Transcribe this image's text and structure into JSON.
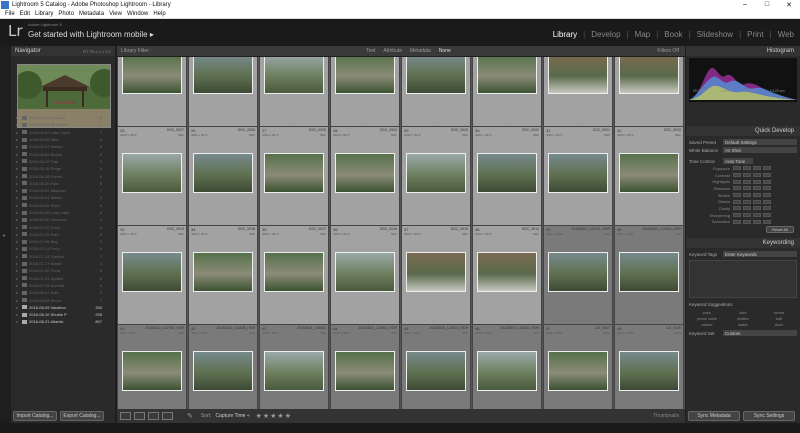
{
  "window": {
    "title": "Lightroom 5 Catalog - Adobe Photoshop Lightroom - Library",
    "controls": [
      "–",
      "□",
      "✕"
    ]
  },
  "menu": [
    "File",
    "Edit",
    "Library",
    "Photo",
    "Metadata",
    "View",
    "Window",
    "Help"
  ],
  "identity": {
    "logo": "Lr",
    "sub": "Adobe Lightroom 5",
    "main": "Get started with Lightroom mobile ▸"
  },
  "modules": [
    "Library",
    "Develop",
    "Map",
    "Book",
    "Slideshow",
    "Print",
    "Web"
  ],
  "active_module": "Library",
  "navigator": {
    "title": "Navigator",
    "options": "FIT  FILL  1:1  3:1"
  },
  "folders": [
    {
      "name": "2018-06-01 Lookout",
      "count": "6"
    },
    {
      "name": "2018-06-02 Mt Rainier",
      "count": "4"
    },
    {
      "name": "2018-06-03 Lake Clark",
      "count": "7"
    },
    {
      "name": "2018-06-05 Hike",
      "count": "8"
    },
    {
      "name": "2018-06-07 Harbor",
      "count": "5"
    },
    {
      "name": "2018-06-09 Beach",
      "count": "3"
    },
    {
      "name": "2018-06-12 Trail",
      "count": "9"
    },
    {
      "name": "2018-06-15 Ridge",
      "count": "4"
    },
    {
      "name": "2018-06-18 Forest",
      "count": "6"
    },
    {
      "name": "2018-06-20 Falls",
      "count": "5"
    },
    {
      "name": "2018-06-22 Meadow",
      "count": "7"
    },
    {
      "name": "2018-06-24 Marsh",
      "count": "3"
    },
    {
      "name": "2018-06-26 River",
      "count": "8"
    },
    {
      "name": "2018-06-28 Long Lake",
      "count": "6"
    },
    {
      "name": "2018-06-30 Overlook",
      "count": "4"
    },
    {
      "name": "2018-07-02 Cove",
      "count": "5"
    },
    {
      "name": "2018-07-05 Park",
      "count": "9"
    },
    {
      "name": "2018-07-08 Bay",
      "count": "3"
    },
    {
      "name": "2018-07-11 Ferry",
      "count": "6"
    },
    {
      "name": "2018-07-14 Garden",
      "count": "7"
    },
    {
      "name": "2018-07-17 Island",
      "count": "4"
    },
    {
      "name": "2018-07-20 Pond",
      "count": "5"
    },
    {
      "name": "2018-07-24 Upland",
      "count": "8"
    },
    {
      "name": "2018-07-28 Summit",
      "count": "6"
    },
    {
      "name": "2018-08-01 Rain",
      "count": "3"
    },
    {
      "name": "2018-08-05 Shore",
      "count": "7"
    },
    {
      "name": "2018-08-09 Vacation",
      "count": "340",
      "lit": true
    },
    {
      "name": "2018-08-10 Shubie P",
      "count": "298",
      "lit": true
    },
    {
      "name": "2018-08-31 Atlantic",
      "count": "807",
      "lit": true
    }
  ],
  "left_buttons": {
    "import": "Import Catalog...",
    "export": "Export Catalog..."
  },
  "filter_bar": {
    "title": "Library Filter :",
    "options": [
      "Text",
      "Attribute",
      "Metadata",
      "None"
    ],
    "active": "None",
    "off": "Filters Off"
  },
  "grid": [
    [
      {
        "n": "17",
        "f": "DSC_0933",
        "d": "4000 x 3072",
        "t": "NEF",
        "c": "g1",
        "s": 1
      },
      {
        "n": "18",
        "f": "DSC_0934",
        "d": "4000 x 3072",
        "t": "NEF",
        "c": "g2",
        "s": 1
      },
      {
        "n": "19",
        "f": "DSC_0935",
        "d": "4000 x 3072",
        "t": "NEF",
        "c": "g3",
        "s": 1
      },
      {
        "n": "20",
        "f": "DSC_0930",
        "d": "4000 x 3072",
        "t": "NEF",
        "c": "g1",
        "s": 1
      },
      {
        "n": "21",
        "f": "DSC_0931",
        "d": "4000 x 3072",
        "t": "NEF",
        "c": "g2",
        "s": 1
      },
      {
        "n": "22",
        "f": "DSC_0932",
        "d": "4000 x 3072",
        "t": "NEF",
        "c": "g1",
        "s": 1
      },
      {
        "n": "23",
        "f": "DSC_0929",
        "d": "4000 x 3072",
        "t": "NEF",
        "c": "g4",
        "s": 1
      },
      {
        "n": "24",
        "f": "DSC_0928",
        "d": "4000 x 3072",
        "t": "NEF",
        "c": "g4",
        "s": 1
      }
    ],
    [
      {
        "n": "25",
        "f": "DSC_0927",
        "d": "4000 x 3072",
        "t": "NEF",
        "c": "g3",
        "s": 1
      },
      {
        "n": "26",
        "f": "DSC_0926",
        "d": "4000 x 3072",
        "t": "NEF",
        "c": "g2",
        "s": 1
      },
      {
        "n": "27",
        "f": "DSC_0925",
        "d": "4000 x 3072",
        "t": "NEF",
        "c": "g1",
        "s": 1
      },
      {
        "n": "28",
        "f": "DSC_0924",
        "d": "4000 x 3072",
        "t": "NEF",
        "c": "g1",
        "s": 1
      },
      {
        "n": "29",
        "f": "DSC_0923",
        "d": "4000 x 3072",
        "t": "NEF",
        "c": "g3",
        "s": 1
      },
      {
        "n": "30",
        "f": "DSC_0922",
        "d": "4000 x 3072",
        "t": "NEF",
        "c": "g2",
        "s": 1
      },
      {
        "n": "31",
        "f": "DSC_0921",
        "d": "4000 x 3072",
        "t": "NEF",
        "c": "g2",
        "s": 1
      },
      {
        "n": "32",
        "f": "DSC_0920",
        "d": "4000 x 3072",
        "t": "NEF",
        "c": "g1",
        "s": 1
      }
    ],
    [
      {
        "n": "33",
        "f": "DSC_0919",
        "d": "4000 x 3072",
        "t": "NEF",
        "c": "g2",
        "s": 1
      },
      {
        "n": "34",
        "f": "DSC_0918",
        "d": "4000 x 3072",
        "t": "NEF",
        "c": "g1",
        "s": 1
      },
      {
        "n": "35",
        "f": "DSC_0917",
        "d": "4000 x 3072",
        "t": "NEF",
        "c": "g1",
        "s": 1
      },
      {
        "n": "36",
        "f": "DSC_0916",
        "d": "4000 x 3072",
        "t": "NEF",
        "c": "g3",
        "s": 1
      },
      {
        "n": "37",
        "f": "DSC_0915",
        "d": "4000 x 3072",
        "t": "NEF",
        "c": "g4",
        "s": 1
      },
      {
        "n": "38",
        "f": "DSC_0914",
        "d": "4000 x 3072",
        "t": "NEF",
        "c": "g4",
        "s": 1
      },
      {
        "n": "39",
        "f": "20180824_124711_HDR",
        "d": "4032 x 3024",
        "t": "JPG",
        "c": "g2",
        "s": 0
      },
      {
        "n": "40",
        "f": "20180824_124920_HDR",
        "d": "4032 x 3024",
        "t": "JPG",
        "c": "g2",
        "s": 0
      }
    ],
    [
      {
        "n": "41",
        "f": "20180824_132000_HDR",
        "d": "4032 x 3024",
        "t": "JPG",
        "c": "g1",
        "s": 0
      },
      {
        "n": "42",
        "f": "20180824_133458_HDR",
        "d": "4032 x 3024",
        "t": "JPG",
        "c": "g2",
        "s": 0
      },
      {
        "n": "43",
        "f": "20180824_133604",
        "d": "4032 x 3024",
        "t": "JPG",
        "c": "g3",
        "s": 0
      },
      {
        "n": "44",
        "f": "20180824_133901_HDR",
        "d": "4032 x 3024",
        "t": "JPG",
        "c": "g1",
        "s": 0
      },
      {
        "n": "45",
        "f": "20180824_133001_HDR",
        "d": "4032 x 3024",
        "t": "JPG",
        "c": "g2",
        "s": 0
      },
      {
        "n": "46",
        "f": "20180824_133240_HDR",
        "d": "4032 x 3024",
        "t": "JPG",
        "c": "g3",
        "s": 0
      },
      {
        "n": "47",
        "f": "DJI_0047",
        "d": "4000 x 3000",
        "t": "DNG",
        "c": "g1",
        "s": 0
      },
      {
        "n": "48",
        "f": "DJI_0048",
        "d": "4000 x 3000",
        "t": "DNG",
        "c": "g2",
        "s": 0
      }
    ]
  ],
  "histogram": {
    "title": "Histogram",
    "iso": "ISO 100",
    "focal": "18 mm",
    "aperture": "f / 5.6",
    "shutter": "1/125 sec",
    "colors": [
      "#e040e0",
      "#40c0ff",
      "#ffffff",
      "#e0e040"
    ]
  },
  "quick_develop": {
    "title": "Quick Develop",
    "saved_preset": {
      "label": "Saved Preset",
      "value": "Default Settings"
    },
    "white_balance": {
      "label": "White Balance",
      "value": "As Shot"
    },
    "tone_control": {
      "label": "Tone Control",
      "value": "Auto Tone"
    },
    "tone_rows": [
      "Exposure",
      "Contrast",
      "Highlights",
      "Shadows",
      "Whites",
      "Blacks",
      "Clarity",
      "Sharpening",
      "Saturation"
    ],
    "reset": "Reset All"
  },
  "keywording": {
    "title": "Keywording",
    "tags_label": "Keyword Tags",
    "tags_value": "Enter Keywords",
    "suggestions_title": "Keyword Suggestions",
    "suggestions": [
      "park",
      "lake",
      "forest",
      "picnic table",
      "shelter",
      "trail",
      "nature",
      "water",
      "dock"
    ],
    "set_label": "Keyword Set",
    "set_value": "Custom"
  },
  "toolbar": {
    "sort_label": "Sort:",
    "sort_value": "Capture Time ÷",
    "stars": "★★★★★",
    "thumbs": "Thumbnails"
  },
  "right_buttons": {
    "sync_meta": "Sync Metadata",
    "sync_settings": "Sync Settings"
  },
  "colors": {
    "accent": "#3b74c4",
    "selected_cell": "#a2a2a2",
    "panel": "#2a2a2a"
  }
}
